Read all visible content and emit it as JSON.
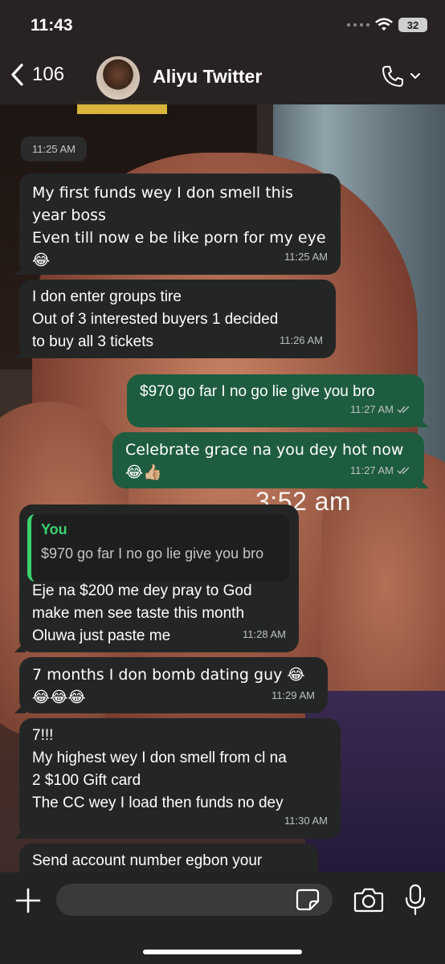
{
  "status_bar": {
    "time": "11:43",
    "battery": "32"
  },
  "header": {
    "back_count": "106",
    "contact_name": "Aliyu Twitter"
  },
  "wallpaper_time": "3:52 am",
  "date_chip": "11:25 AM",
  "messages": [
    {
      "dir": "in",
      "text": "My first funds wey I don smell this\nyear boss\nEven till now e be like porn for my eye\n😂",
      "time": "11:25 AM"
    },
    {
      "dir": "in",
      "text": "I don enter groups tire\nOut of 3 interested buyers 1 decided\nto buy all 3 tickets",
      "time": "11:26 AM"
    },
    {
      "dir": "out",
      "text": "$970 go far I no go lie give you bro",
      "time": "11:27 AM"
    },
    {
      "dir": "out",
      "text": "Celebrate grace na you dey hot now\n😂👍🏼",
      "time": "11:27 AM"
    },
    {
      "dir": "in",
      "quote_author": "You",
      "quote_text": "$970 go far I no go lie give you bro",
      "text": "Eje na $200 me dey pray to God\nmake men see taste this month\nOluwa just paste me",
      "time": "11:28 AM"
    },
    {
      "dir": "in",
      "text": "7 months I don bomb dating guy 😂\n😂😂😂",
      "time": "11:29 AM"
    },
    {
      "dir": "in",
      "text": "7!!!\nMy highest wey I don smell from cl na\n2 $100 Gift card\nThe CC wey I load then funds no dey",
      "time": "11:30 AM"
    },
    {
      "dir": "in",
      "text": "Send account number egbon your",
      "time": ""
    }
  ],
  "input": {
    "placeholder": ""
  },
  "colors": {
    "incoming_bubble": "#242626",
    "outgoing_bubble": "#1e5c3f",
    "quote_accent": "#3ad36e",
    "read_ticks": "#b9c2bd"
  },
  "icons": [
    "chevron-left-icon",
    "phone-icon",
    "chevron-down-icon",
    "plus-icon",
    "sticker-icon",
    "camera-icon",
    "mic-icon",
    "double-check-icon",
    "wifi-icon"
  ]
}
